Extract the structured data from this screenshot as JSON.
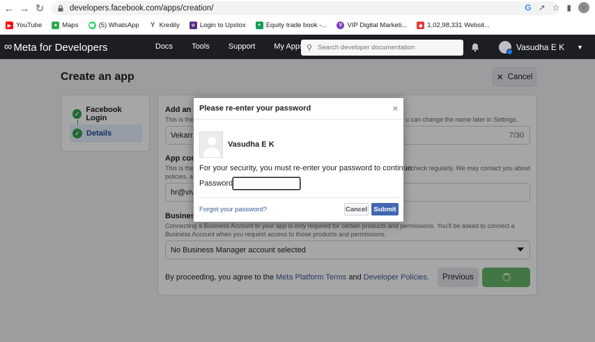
{
  "browser": {
    "url": "developers.facebook.com/apps/creation/",
    "profile_initial": "V",
    "bookmarks": [
      {
        "label": "YouTube",
        "icon": "youtube-icon",
        "color": "#ff0000"
      },
      {
        "label": "Maps",
        "icon": "maps-icon",
        "color": "#34a853"
      },
      {
        "label": "(5) WhatsApp",
        "icon": "whatsapp-icon",
        "color": "#25d366"
      },
      {
        "label": "Kredily",
        "icon": "kredily-icon",
        "color": "#5b5b5b"
      },
      {
        "label": "Login to Upstox",
        "icon": "upstox-icon",
        "color": "#5a2d82"
      },
      {
        "label": "Equity trade book -...",
        "icon": "sheets-icon",
        "color": "#0f9d58"
      },
      {
        "label": "VIP Digital Marketi...",
        "icon": "vip-icon",
        "color": "#7e3fbf"
      },
      {
        "label": "1,02,98,331 Websit...",
        "icon": "website-icon",
        "color": "#e53935"
      }
    ]
  },
  "meta_nav": {
    "logo": "Meta for Developers",
    "links": [
      "Docs",
      "Tools",
      "Support",
      "My Apps"
    ],
    "search_placeholder": "Search developer documentation",
    "user_name": "Vasudha E K"
  },
  "page": {
    "title": "Create an app",
    "cancel_label": "Cancel",
    "steps": [
      "Facebook Login",
      "Details"
    ],
    "form": {
      "app_name_label": "Add an ap",
      "app_name_help": "This is the",
      "app_name_help_right": "u can change the name later in Settings.",
      "app_name_value": "Vekarna",
      "app_name_count": "7/30",
      "contact_label": "App conta",
      "contact_help": "This is the",
      "contact_help_right": "u check regularly. We may contact you about",
      "contact_help_2": "policies, ap",
      "contact_value": "hr@vivi",
      "business_label": "Business",
      "business_help": "Connecting a Business Account to your app is only required for certain products and permissions. You'll be asked to connect a Business Account when you request access to those products and permissions.",
      "business_value": "No Business Manager account selected",
      "terms_prefix": "By proceeding, you agree to the",
      "terms_link1": "Meta Platform Terms",
      "terms_and": "and",
      "terms_link2": "Developer Policies",
      "terms_suffix": ".",
      "previous_label": "Previous"
    }
  },
  "modal": {
    "title": "Please re-enter your password",
    "close_symbol": "×",
    "user_name": "Vasudha E K",
    "message": "For your security, you must re-enter your password to continue.",
    "password_label": "Password:",
    "password_value": "",
    "forgot_link": "Forgot your password?",
    "cancel_label": "Cancel",
    "submit_label": "Submit"
  }
}
